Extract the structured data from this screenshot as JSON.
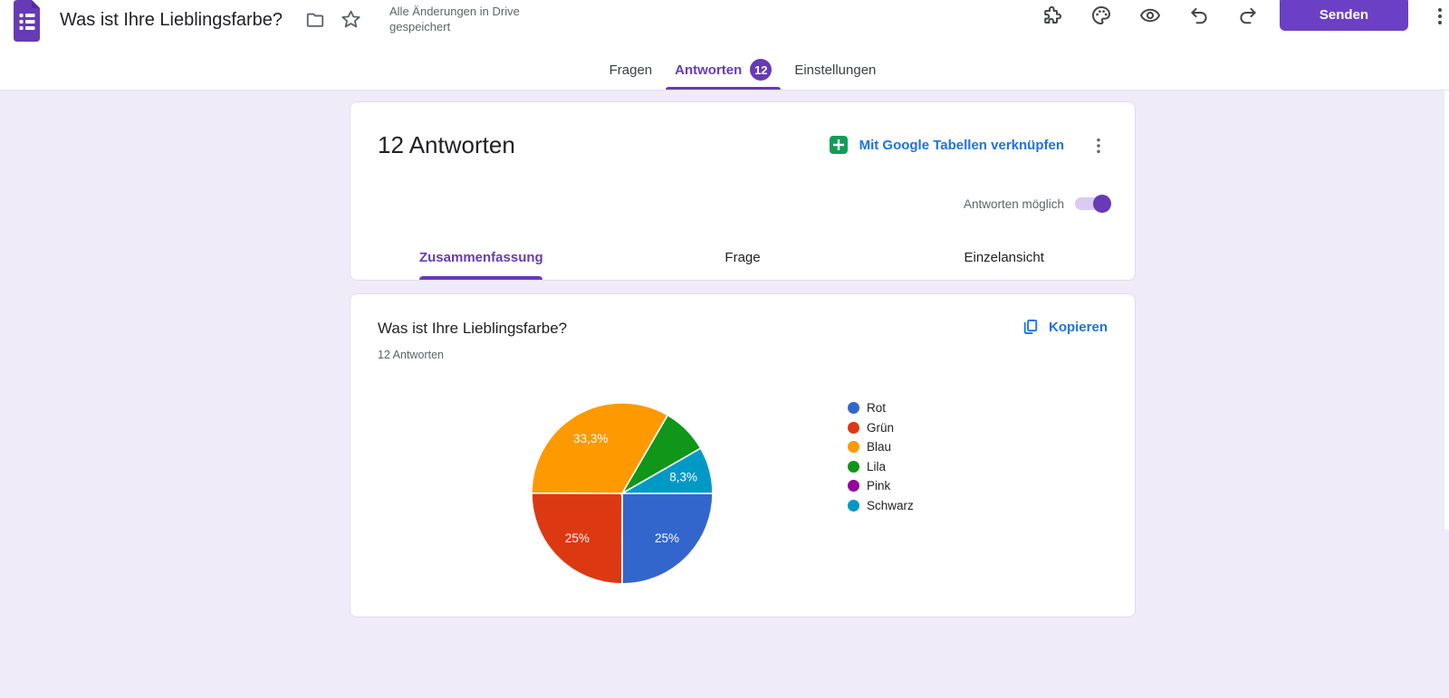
{
  "theme": {
    "accent": "#673ab7",
    "link": "#1a73e8",
    "background": "#f0ebf8",
    "send_button": "#6c40c4",
    "sheets_green": "#0f9d58",
    "toolbar_icon": "#444746",
    "text_primary": "#202124",
    "text_secondary": "#5f6368",
    "toggle_track": "#d9cbf2",
    "card_border": "#e1dded"
  },
  "header": {
    "form_title": "Was ist Ihre Lieblingsfarbe?",
    "save_status": "Alle Änderungen in Drive gespeichert",
    "send_label": "Senden",
    "left_icons": [
      "forms-logo-icon",
      "folder-move-icon",
      "star-icon"
    ],
    "toolbar_icons": [
      "extensions-icon",
      "theme-palette-icon",
      "preview-eye-icon",
      "undo-icon",
      "redo-icon",
      "more-options-icon"
    ],
    "tabs": [
      {
        "label": "Fragen",
        "active": false
      },
      {
        "label": "Antworten",
        "badge": "12",
        "active": true
      },
      {
        "label": "Einstellungen",
        "active": false
      }
    ]
  },
  "summary_card": {
    "responses_heading": "12 Antworten",
    "sheets_link_label": "Mit Google Tabellen verknüpfen",
    "sheets_icon": "google-sheets-icon",
    "more_icon": "more-options-icon",
    "accepting_toggle": {
      "label": "Antworten möglich",
      "state": "on"
    },
    "subtabs": [
      {
        "label": "Zusammenfassung",
        "active": true
      },
      {
        "label": "Frage",
        "active": false
      },
      {
        "label": "Einzelansicht",
        "active": false
      }
    ]
  },
  "question_card": {
    "title": "Was ist Ihre Lieblingsfarbe?",
    "response_count": "12 Antworten",
    "copy_label": "Kopieren",
    "copy_icon": "copy-icon"
  },
  "chart_data": {
    "type": "pie",
    "title": "Was ist Ihre Lieblingsfarbe?",
    "total_responses": 12,
    "start_angle_deg": 0,
    "direction": "clockwise",
    "legend_position": "right",
    "slices": [
      {
        "label": "Rot",
        "count": 3,
        "percent": 25,
        "percent_label": "25%",
        "color": "#3366cc",
        "show_label": true
      },
      {
        "label": "Grün",
        "count": 3,
        "percent": 25,
        "percent_label": "25%",
        "color": "#dc3912",
        "show_label": true
      },
      {
        "label": "Blau",
        "count": 4,
        "percent": 33.3,
        "percent_label": "33,3%",
        "color": "#ff9900",
        "show_label": true
      },
      {
        "label": "Lila",
        "count": 1,
        "percent": 8.3,
        "percent_label": "8,3%",
        "color": "#109618",
        "show_label": false
      },
      {
        "label": "Pink",
        "count": 0,
        "percent": 0,
        "percent_label": "",
        "color": "#990099",
        "show_label": false
      },
      {
        "label": "Schwarz",
        "count": 1,
        "percent": 8.3,
        "percent_label": "8,3%",
        "color": "#0099c6",
        "show_label": true
      }
    ]
  }
}
